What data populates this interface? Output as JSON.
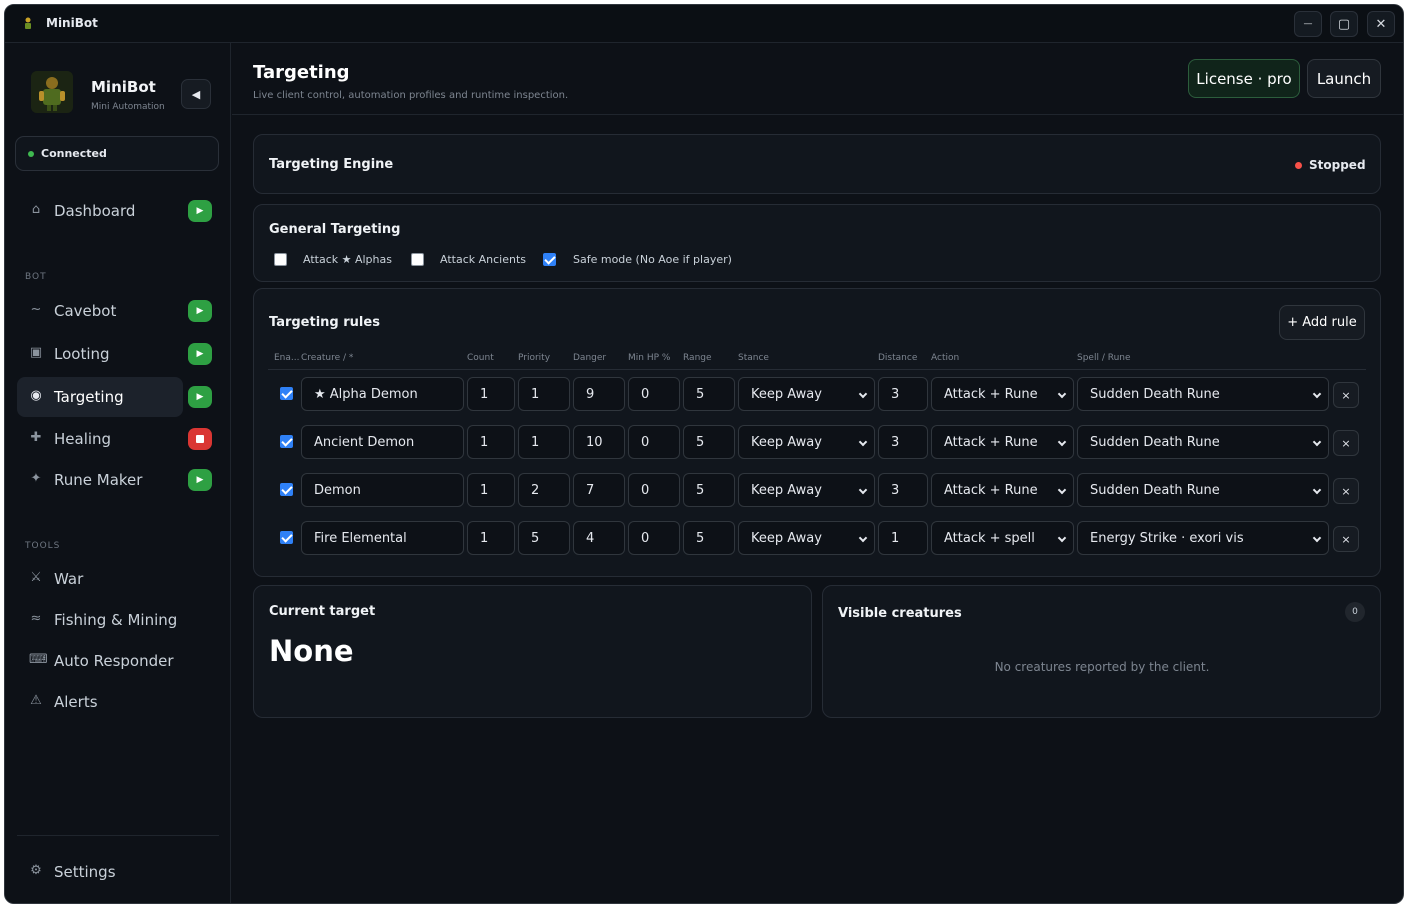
{
  "window": {
    "title": "MiniBot",
    "controls": {
      "minimize": "—",
      "maximize": "▢",
      "close": "✕"
    }
  },
  "sidebar": {
    "brand_name": "MiniBot",
    "brand_subtitle": "Mini Automation",
    "connection_status": "Connected",
    "nav_top": [
      {
        "label": "Dashboard",
        "icon": "home-icon",
        "glyph": "⌂",
        "control": "play"
      }
    ],
    "bot_section_label": "BOT",
    "bot_items": [
      {
        "label": "Cavebot",
        "icon": "route-icon",
        "glyph": "~",
        "control": "play"
      },
      {
        "label": "Looting",
        "icon": "loot-box-icon",
        "glyph": "▣",
        "control": "play"
      },
      {
        "label": "Targeting",
        "icon": "target-icon",
        "glyph": "◉",
        "control": "play",
        "active": true
      },
      {
        "label": "Healing",
        "icon": "plus-icon",
        "glyph": "✚",
        "control": "stop"
      },
      {
        "label": "Rune Maker",
        "icon": "sparkle-icon",
        "glyph": "✦",
        "control": "play"
      }
    ],
    "tools_section_label": "TOOLS",
    "tool_items": [
      {
        "label": "War",
        "icon": "swords-icon",
        "glyph": "⚔"
      },
      {
        "label": "Fishing & Mining",
        "icon": "waves-icon",
        "glyph": "≈"
      },
      {
        "label": "Auto Responder",
        "icon": "keyboard-icon",
        "glyph": "⌨"
      },
      {
        "label": "Alerts",
        "icon": "warning-icon",
        "glyph": "⚠"
      }
    ],
    "settings_label": "Settings",
    "settings_icon": "gear-icon",
    "colors": {
      "play": "#2ea043",
      "stop": "#da3633",
      "connected": "#3fb950"
    }
  },
  "header": {
    "title": "Targeting",
    "subtitle": "Live client control, automation profiles and runtime inspection.",
    "license_label": "License · pro",
    "launch_label": "Launch"
  },
  "engine": {
    "title": "Targeting Engine",
    "status": "Stopped",
    "status_color": "#f85149"
  },
  "general": {
    "title": "General Targeting",
    "options": [
      {
        "label": "Attack ★ Alphas",
        "checked": false
      },
      {
        "label": "Attack Ancients",
        "checked": false
      },
      {
        "label": "Safe mode (No Aoe if player)",
        "checked": true
      }
    ]
  },
  "rules": {
    "title": "Targeting rules",
    "add_label": "+ Add rule",
    "columns": [
      "Ena...",
      "Creature / *",
      "Count",
      "Priority",
      "Danger",
      "Min HP %",
      "Range",
      "Stance",
      "Distance",
      "Action",
      "Spell / Rune"
    ],
    "rows": [
      {
        "enabled": true,
        "creature": "★ Alpha Demon",
        "count": "1",
        "priority": "1",
        "danger": "9",
        "min_hp": "0",
        "range": "5",
        "stance": "Keep Away",
        "distance": "3",
        "action": "Attack + Rune",
        "spell": "Sudden Death Rune"
      },
      {
        "enabled": true,
        "creature": "Ancient Demon",
        "count": "1",
        "priority": "1",
        "danger": "10",
        "min_hp": "0",
        "range": "5",
        "stance": "Keep Away",
        "distance": "3",
        "action": "Attack + Rune",
        "spell": "Sudden Death Rune"
      },
      {
        "enabled": true,
        "creature": "Demon",
        "count": "1",
        "priority": "2",
        "danger": "7",
        "min_hp": "0",
        "range": "5",
        "stance": "Keep Away",
        "distance": "3",
        "action": "Attack + Rune",
        "spell": "Sudden Death Rune"
      },
      {
        "enabled": true,
        "creature": "Fire Elemental",
        "count": "1",
        "priority": "5",
        "danger": "4",
        "min_hp": "0",
        "range": "5",
        "stance": "Keep Away",
        "distance": "1",
        "action": "Attack + spell",
        "spell": "Energy Strike · exori vis"
      }
    ],
    "delete_glyph": "×"
  },
  "current_target": {
    "title": "Current target",
    "value": "None"
  },
  "visible_creatures": {
    "title": "Visible creatures",
    "count": "0",
    "empty_message": "No creatures reported by the client."
  }
}
